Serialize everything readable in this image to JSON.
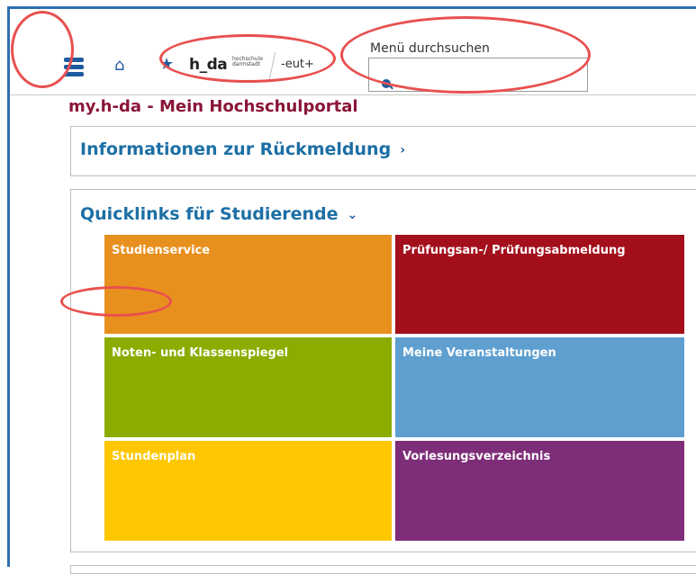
{
  "page": {
    "title": "my.h-da - Mein Hochschulportal"
  },
  "header": {
    "logo_main": "h_da",
    "logo_sub1": "hochschule",
    "logo_sub2": "darmstadt",
    "logo_partner": "-eut+",
    "search": {
      "label": "Menü durchsuchen",
      "value": ""
    }
  },
  "panels": {
    "info": {
      "title": "Informationen zur Rückmeldung",
      "chevron": "›"
    },
    "quicklinks": {
      "title": "Quicklinks für Studierende",
      "chevron": "⌄",
      "tiles": [
        {
          "label": "Studienservice",
          "color": "#e8901e"
        },
        {
          "label": "Prüfungsan-/ Prüfungsabmeldung",
          "color": "#a30f1b"
        },
        {
          "label": "Noten- und Klassenspiegel",
          "color": "#8cac00"
        },
        {
          "label": "Meine Veranstaltungen",
          "color": "#5e9fd0"
        },
        {
          "label": "Stundenplan",
          "color": "#ffc700"
        },
        {
          "label": "Vorlesungsverzeichnis",
          "color": "#7e2d78"
        }
      ]
    }
  },
  "icons": {
    "menu": "hamburger-menu-icon",
    "home": "home-icon",
    "favorites": "star-icon",
    "search": "search-icon"
  },
  "colors": {
    "brand_blue": "#1d5a9e",
    "title_red": "#8a1538",
    "link_blue": "#1d6fa5",
    "annotation": "#e8504f"
  }
}
